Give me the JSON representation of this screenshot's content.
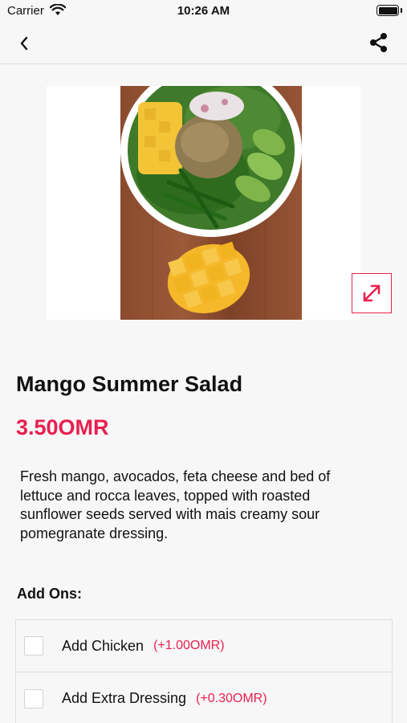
{
  "status_bar": {
    "carrier": "Carrier",
    "time": "10:26 AM"
  },
  "icons": {
    "back": "chevron-left-icon",
    "share": "share-icon",
    "expand": "expand-icon"
  },
  "colors": {
    "accent": "#e8204f",
    "background": "#f7f7f7",
    "text": "#111111"
  },
  "product": {
    "title": "Mango Summer Salad",
    "price": "3.50OMR",
    "description": "Fresh mango, avocados, feta cheese and bed of lettuce and rocca leaves, topped with roasted sunflower seeds served with mais creamy sour pomegranate dressing."
  },
  "addons": {
    "heading": "Add Ons:",
    "items": [
      {
        "name": "Add Chicken",
        "price": "(+1.00OMR)",
        "checked": false
      },
      {
        "name": "Add Extra Dressing",
        "price": "(+0.30OMR)",
        "checked": false
      }
    ]
  }
}
